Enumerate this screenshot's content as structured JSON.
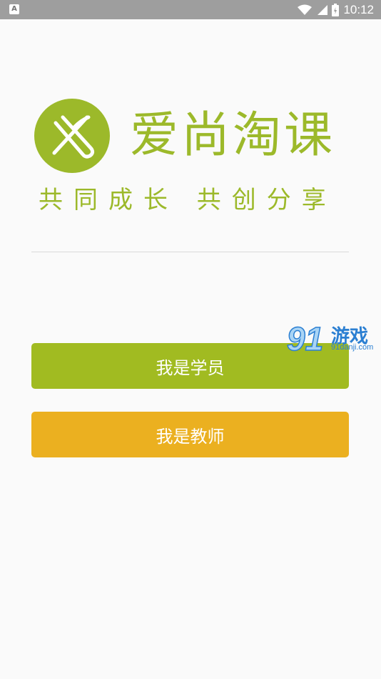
{
  "status_bar": {
    "app_indicator": "A",
    "time": "10:12",
    "icons": [
      "wifi-icon",
      "cellular-signal-icon",
      "battery-icon"
    ]
  },
  "brand": {
    "name": "爱尚淘课",
    "slogan": "共同成长  共创分享",
    "color": "#9cb92a"
  },
  "buttons": {
    "student_label": "我是学员",
    "teacher_label": "我是教师",
    "student_color": "#a1bb21",
    "teacher_color": "#ebb020"
  },
  "watermark": {
    "logo": "91",
    "title": "游戏",
    "site": "91danji.com"
  }
}
